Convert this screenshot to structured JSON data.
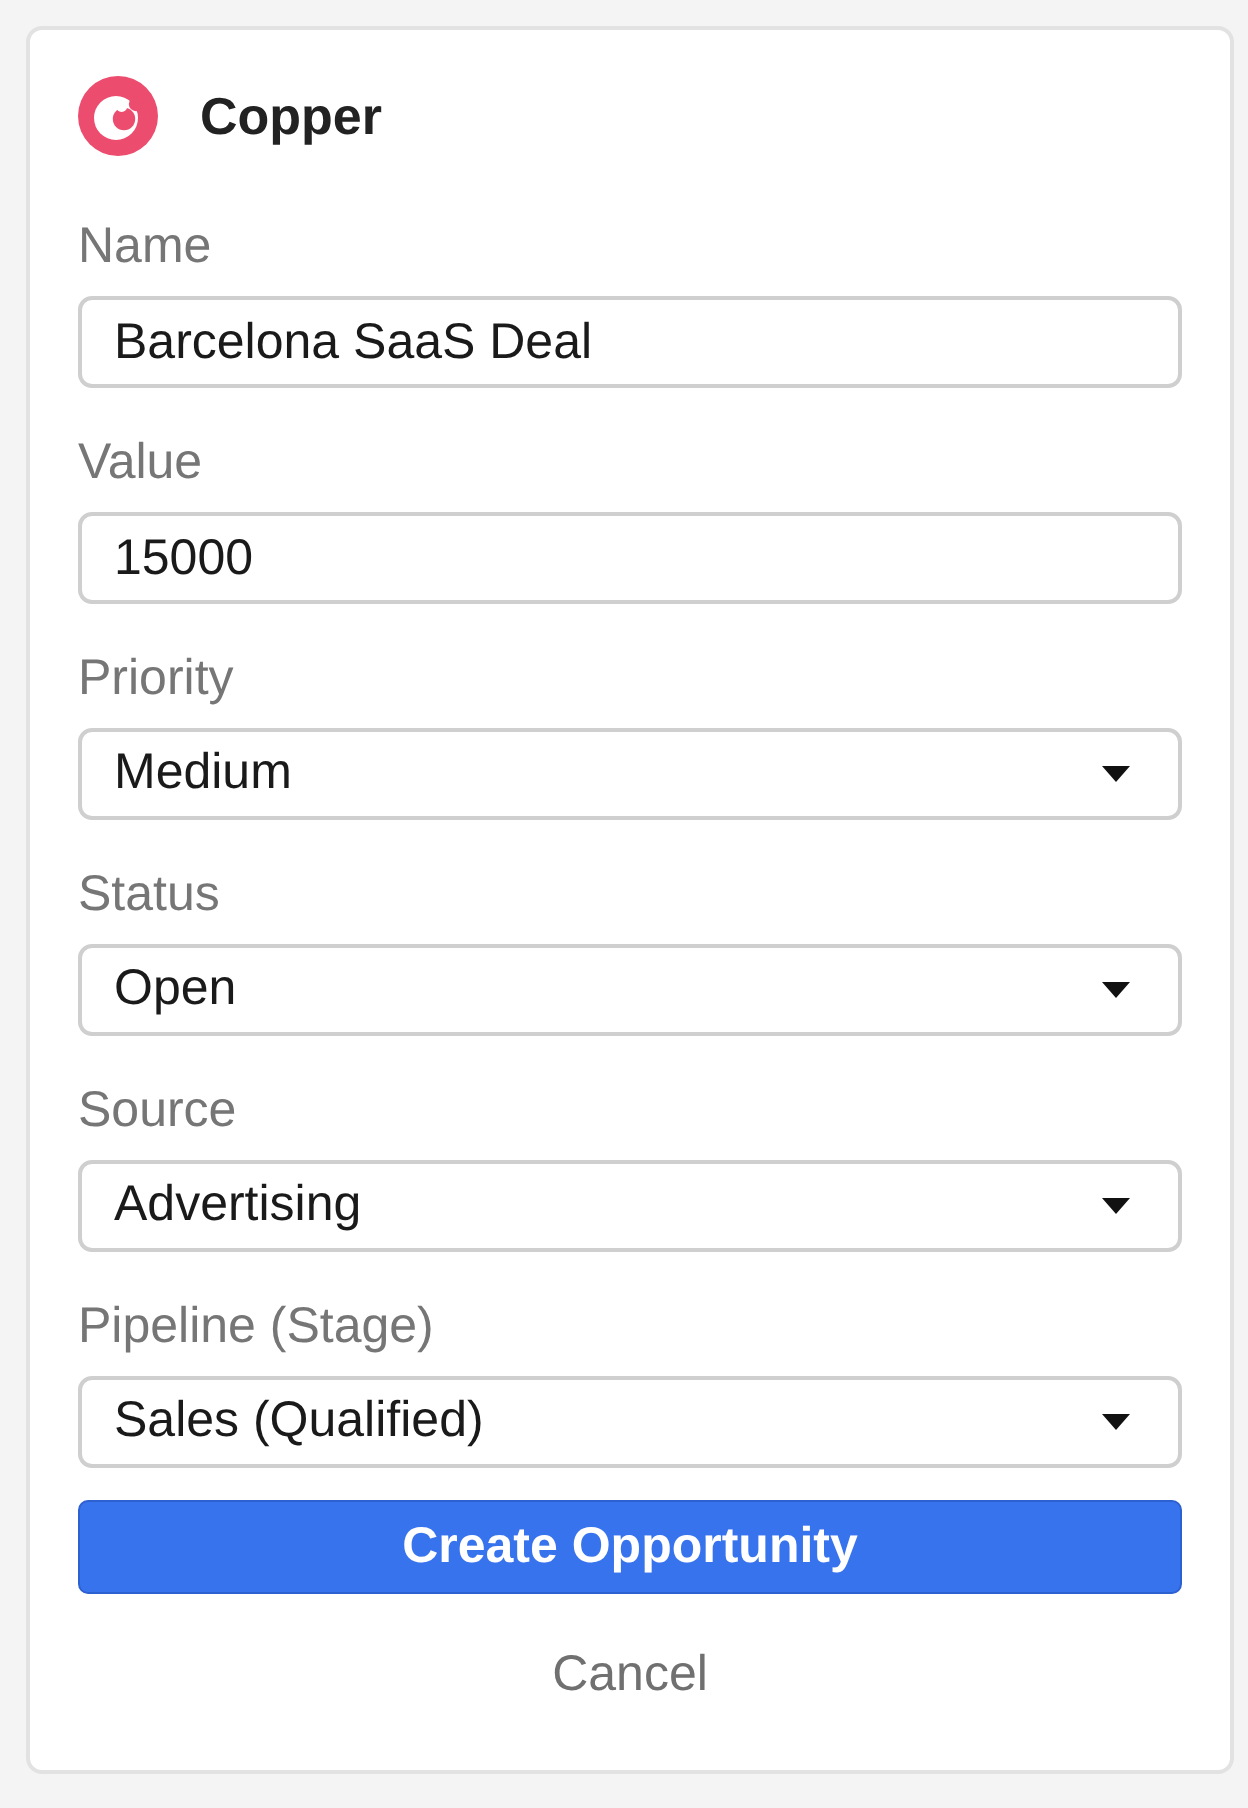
{
  "app": {
    "title": "Copper"
  },
  "fields": [
    {
      "label": "Name",
      "kind": "text",
      "value": "Barcelona SaaS Deal"
    },
    {
      "label": "Value",
      "kind": "text",
      "value": "15000"
    },
    {
      "label": "Priority",
      "kind": "select",
      "value": "Medium"
    },
    {
      "label": "Status",
      "kind": "select",
      "value": "Open"
    },
    {
      "label": "Source",
      "kind": "select",
      "value": "Advertising"
    },
    {
      "label": "Pipeline (Stage)",
      "kind": "select",
      "value": "Sales (Qualified)"
    }
  ],
  "actions": {
    "primary": "Create Opportunity",
    "secondary": "Cancel"
  }
}
